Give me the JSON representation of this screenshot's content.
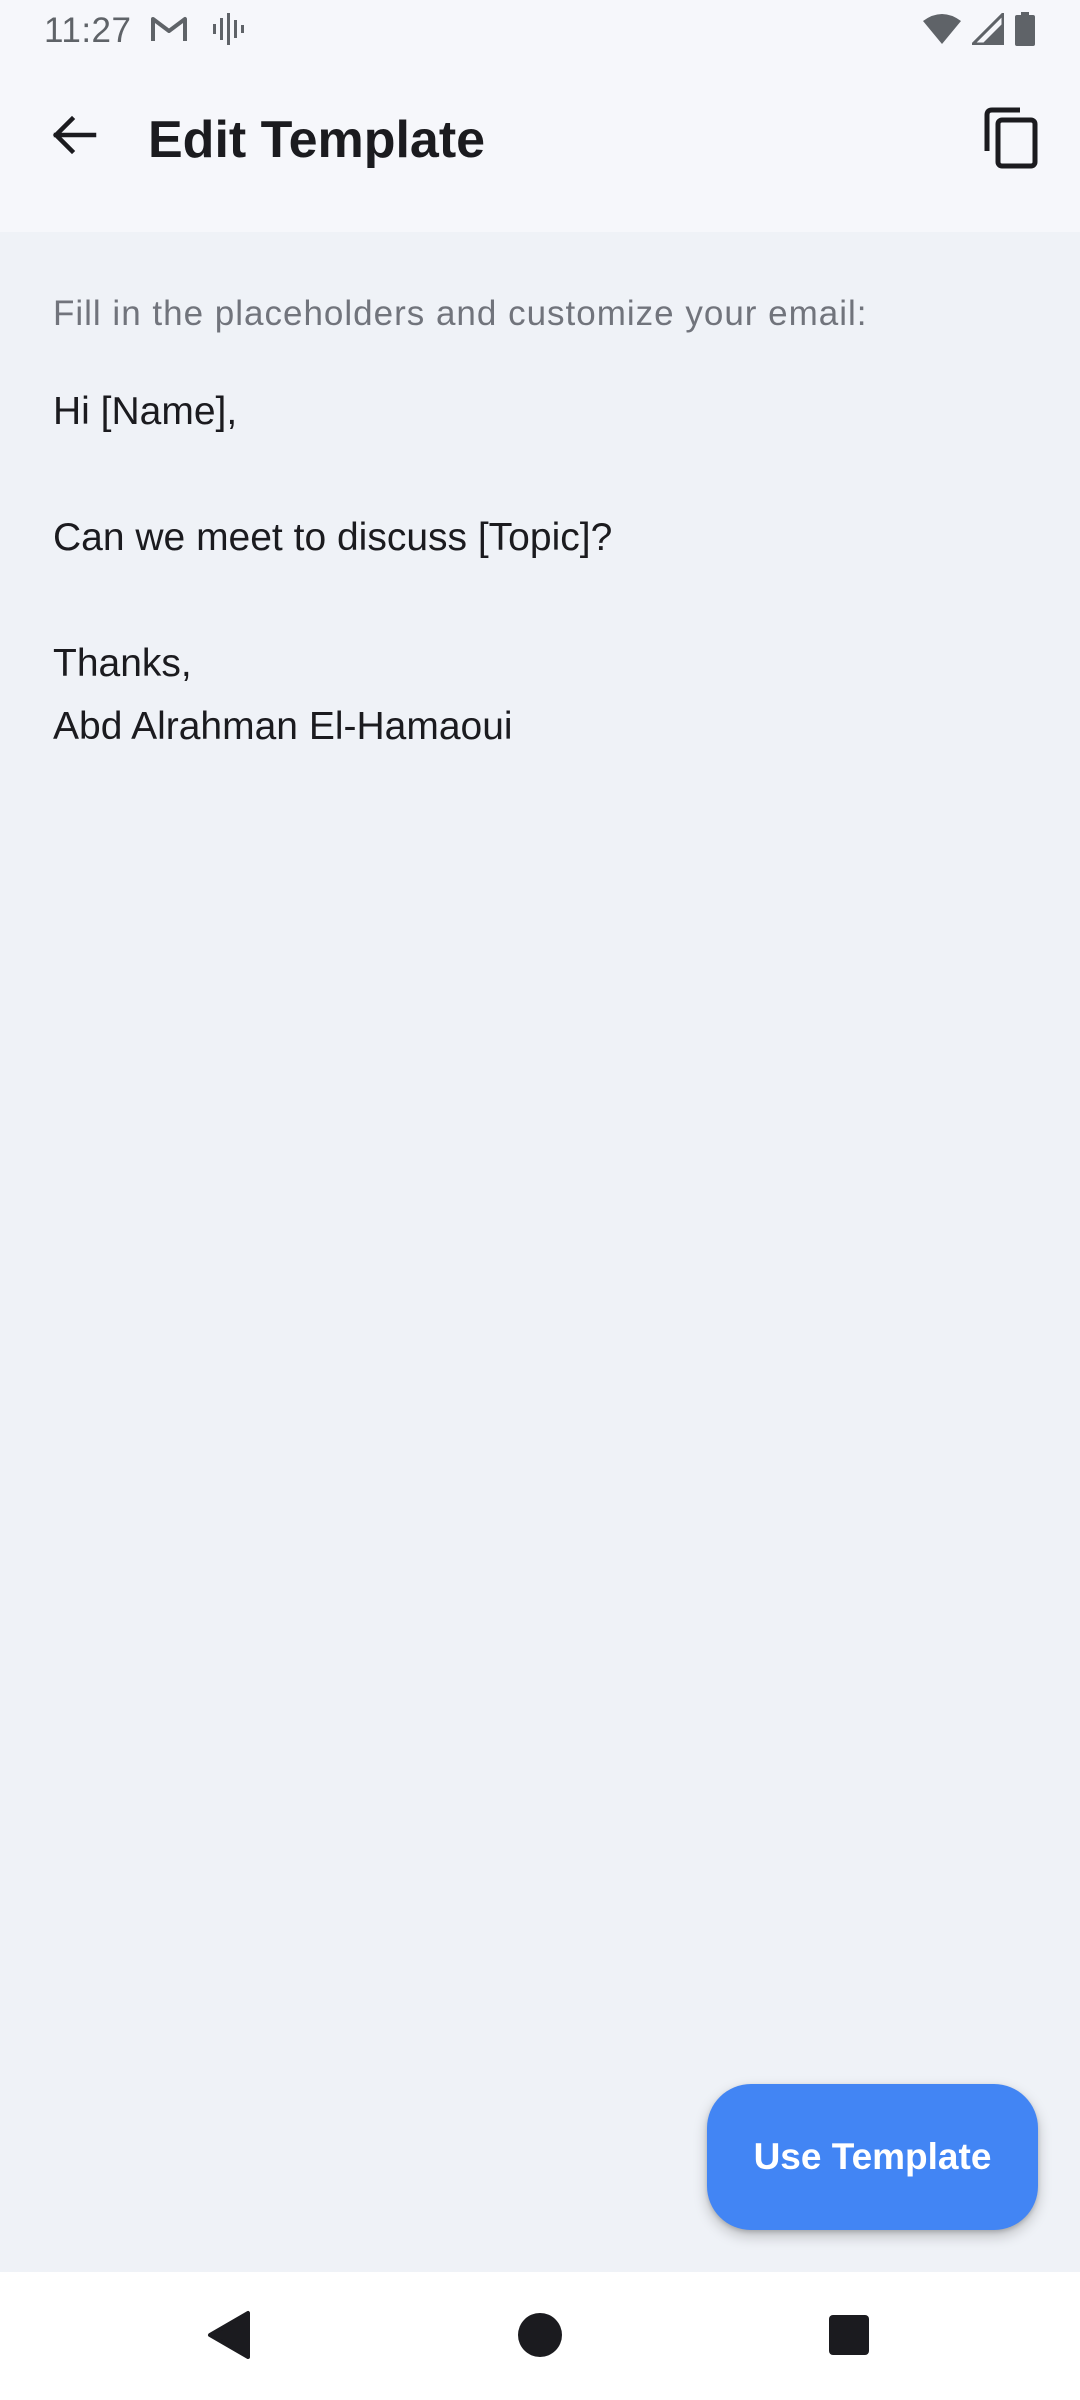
{
  "status_bar": {
    "time": "11:27",
    "icons": [
      "gmail-icon",
      "voice-icon",
      "wifi-icon",
      "signal-icon",
      "battery-icon"
    ]
  },
  "app_bar": {
    "title": "Edit Template",
    "back_icon": "arrow-back-icon",
    "copy_icon": "copy-icon"
  },
  "content": {
    "instruction": "Fill in the placeholders and customize your email:",
    "email_body": "Hi [Name],\n\nCan we meet to discuss [Topic]?\n\nThanks,\nAbd Alrahman El-Hamaoui"
  },
  "fab": {
    "label": "Use Template"
  },
  "colors": {
    "accent": "#4285f4",
    "background": "#eff2f7",
    "app_bar": "#f6f7fb",
    "text_primary": "#1b1b1f",
    "text_secondary": "#71747c"
  },
  "nav_bar": {
    "buttons": [
      "back-triangle-icon",
      "home-circle-icon",
      "recents-square-icon"
    ]
  }
}
